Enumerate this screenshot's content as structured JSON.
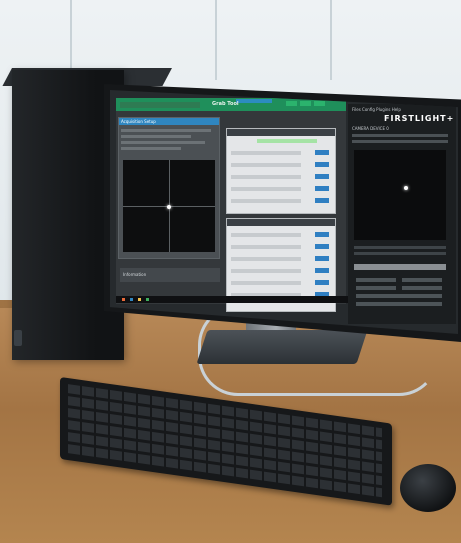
{
  "screen": {
    "left_app": {
      "title": "Grab Tool",
      "acquisition_panel_title": "Acquisition Setup",
      "bottom_panel_title": "Information"
    },
    "right_app": {
      "menu": "Files  Config  Plugins  Help",
      "logo": "FIRSTLIGHT+",
      "status": "CAMERA DEVICE 0"
    }
  },
  "colors": {
    "app_titlebar": "#1f8f5b",
    "panel_header": "#2f86c0",
    "desk": "#b98a59"
  }
}
